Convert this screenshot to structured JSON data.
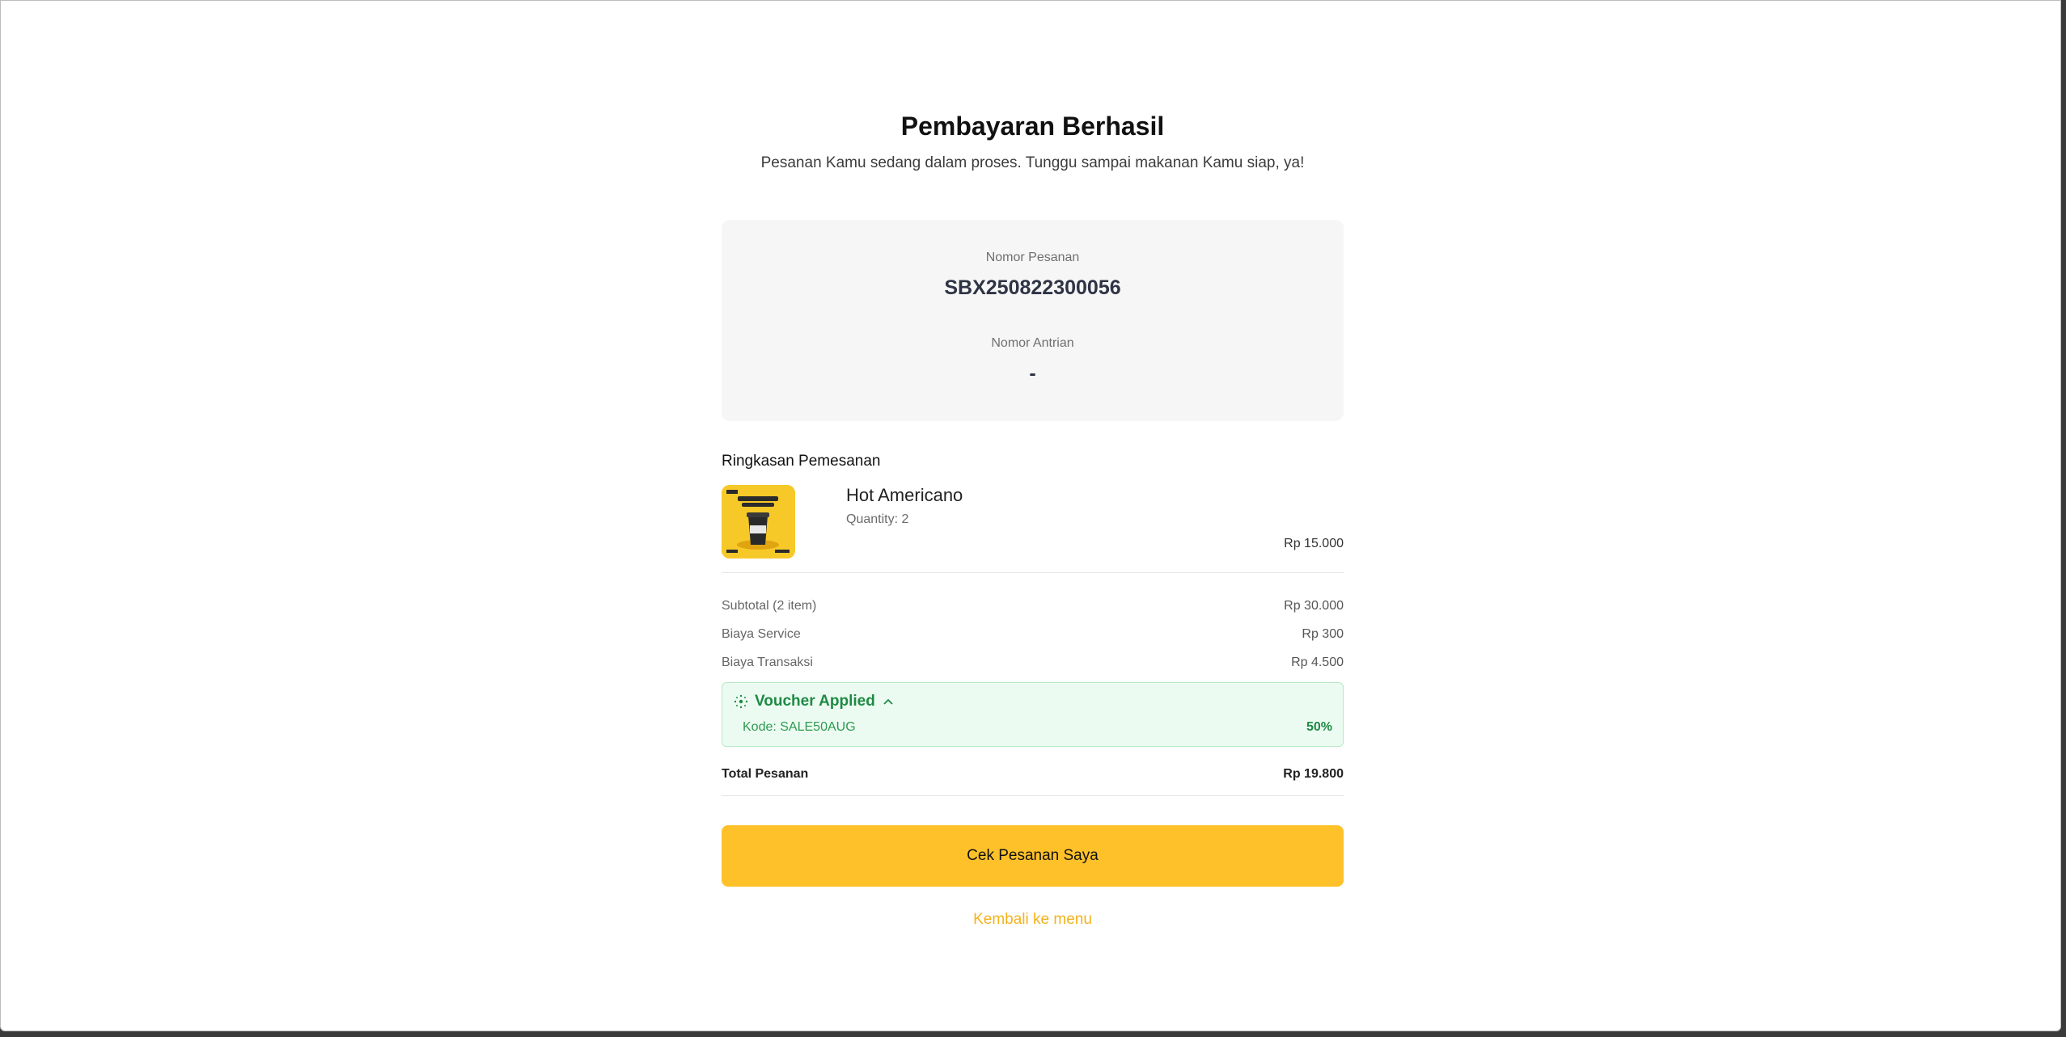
{
  "header": {
    "title": "Pembayaran Berhasil",
    "subtitle": "Pesanan Kamu sedang dalam proses. Tunggu sampai makanan Kamu siap, ya!"
  },
  "order": {
    "number_label": "Nomor Pesanan",
    "number_value": "SBX250822300056",
    "queue_label": "Nomor Antrian",
    "queue_value": "-"
  },
  "summary": {
    "title": "Ringkasan Pemesanan",
    "items": [
      {
        "name": "Hot Americano",
        "quantity": "Quantity: 2",
        "price": "Rp 15.000",
        "image_icon": "coffee-promo-thumbnail"
      }
    ],
    "subtotal_label": "Subtotal (2 item)",
    "subtotal_value": "Rp 30.000",
    "service_label": "Biaya Service",
    "service_value": "Rp 300",
    "transaction_label": "Biaya Transaksi",
    "transaction_value": "Rp 4.500",
    "voucher": {
      "title": "Voucher Applied",
      "code": "Kode: SALE50AUG",
      "discount": "50%",
      "icon": "sparkle-icon",
      "toggle_icon": "chevron-up-icon"
    },
    "total_label": "Total Pesanan",
    "total_value": "Rp 19.800"
  },
  "actions": {
    "primary": "Cek Pesanan Saya",
    "secondary": "Kembali ke menu"
  },
  "colors": {
    "accent": "#FEC12A",
    "link": "#F4B21B",
    "success": "#1F8A44",
    "success_bg": "#ECFBF1"
  }
}
